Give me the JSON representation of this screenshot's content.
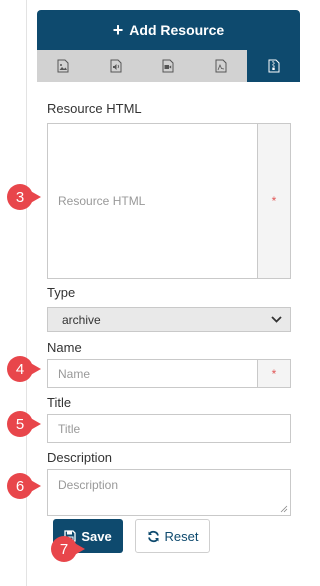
{
  "header": {
    "add_button_label": "Add Resource"
  },
  "type_tabs": [
    {
      "icon": "image-file-icon"
    },
    {
      "icon": "audio-file-icon"
    },
    {
      "icon": "video-file-icon"
    },
    {
      "icon": "pdf-file-icon"
    },
    {
      "icon": "archive-file-icon",
      "active": true
    }
  ],
  "form": {
    "resource_html": {
      "label": "Resource HTML",
      "placeholder": "Resource HTML",
      "required_mark": "*"
    },
    "type": {
      "label": "Type",
      "selected": "archive"
    },
    "name": {
      "label": "Name",
      "placeholder": "Name",
      "required_mark": "*"
    },
    "title": {
      "label": "Title",
      "placeholder": "Title"
    },
    "description": {
      "label": "Description",
      "placeholder": "Description"
    }
  },
  "actions": {
    "save_label": "Save",
    "reset_label": "Reset"
  },
  "callouts": [
    "3",
    "4",
    "5",
    "6",
    "7"
  ],
  "colors": {
    "primary": "#0e4a6e",
    "callout": "#e8464b",
    "tab_bar": "#d2d2d2",
    "required": "#e05656"
  }
}
